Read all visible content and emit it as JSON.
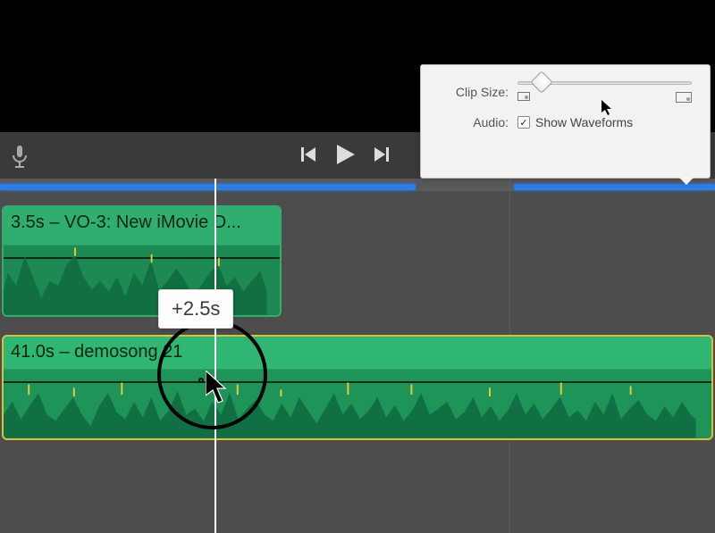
{
  "settings": {
    "clip_size_label": "Clip Size:",
    "audio_label": "Audio:",
    "show_waveforms_label": "Show Waveforms",
    "show_waveforms_checked": "✓"
  },
  "tooltip_value": "+2.5s",
  "clips": {
    "clip1_label": "3.5s – VO-3: New iMovie D...",
    "clip2_label": "41.0s – demosong 21"
  }
}
